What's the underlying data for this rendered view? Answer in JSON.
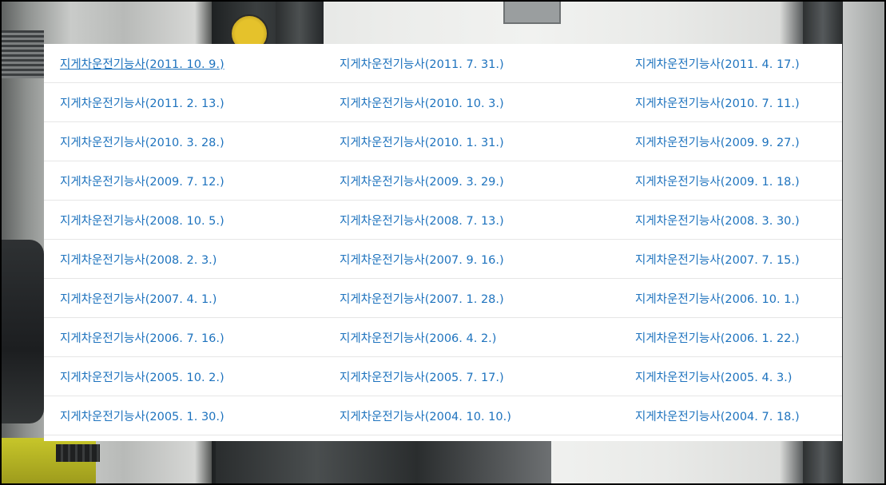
{
  "links": [
    [
      "지게차운전기능사(2011. 10. 9.)",
      "지게차운전기능사(2011. 7. 31.)",
      "지게차운전기능사(2011. 4. 17.)"
    ],
    [
      "지게차운전기능사(2011. 2. 13.)",
      "지게차운전기능사(2010. 10. 3.)",
      "지게차운전기능사(2010. 7. 11.)"
    ],
    [
      "지게차운전기능사(2010. 3. 28.)",
      "지게차운전기능사(2010. 1. 31.)",
      "지게차운전기능사(2009. 9. 27.)"
    ],
    [
      "지게차운전기능사(2009. 7. 12.)",
      "지게차운전기능사(2009. 3. 29.)",
      "지게차운전기능사(2009. 1. 18.)"
    ],
    [
      "지게차운전기능사(2008. 10. 5.)",
      "지게차운전기능사(2008. 7. 13.)",
      "지게차운전기능사(2008. 3. 30.)"
    ],
    [
      "지게차운전기능사(2008. 2. 3.)",
      "지게차운전기능사(2007. 9. 16.)",
      "지게차운전기능사(2007. 7. 15.)"
    ],
    [
      "지게차운전기능사(2007. 4. 1.)",
      "지게차운전기능사(2007. 1. 28.)",
      "지게차운전기능사(2006. 10. 1.)"
    ],
    [
      "지게차운전기능사(2006. 7. 16.)",
      "지게차운전기능사(2006. 4. 2.)",
      "지게차운전기능사(2006. 1. 22.)"
    ],
    [
      "지게차운전기능사(2005. 10. 2.)",
      "지게차운전기능사(2005. 7. 17.)",
      "지게차운전기능사(2005. 4. 3.)"
    ],
    [
      "지게차운전기능사(2005. 1. 30.)",
      "지게차운전기능사(2004. 10. 10.)",
      "지게차운전기능사(2004. 7. 18.)"
    ]
  ],
  "hovered_link": "지게차운전기능사(2011. 10. 9.)",
  "colors": {
    "link": "#1e73be",
    "row_divider": "#e6e6e6",
    "panel_background": "#ffffff"
  }
}
